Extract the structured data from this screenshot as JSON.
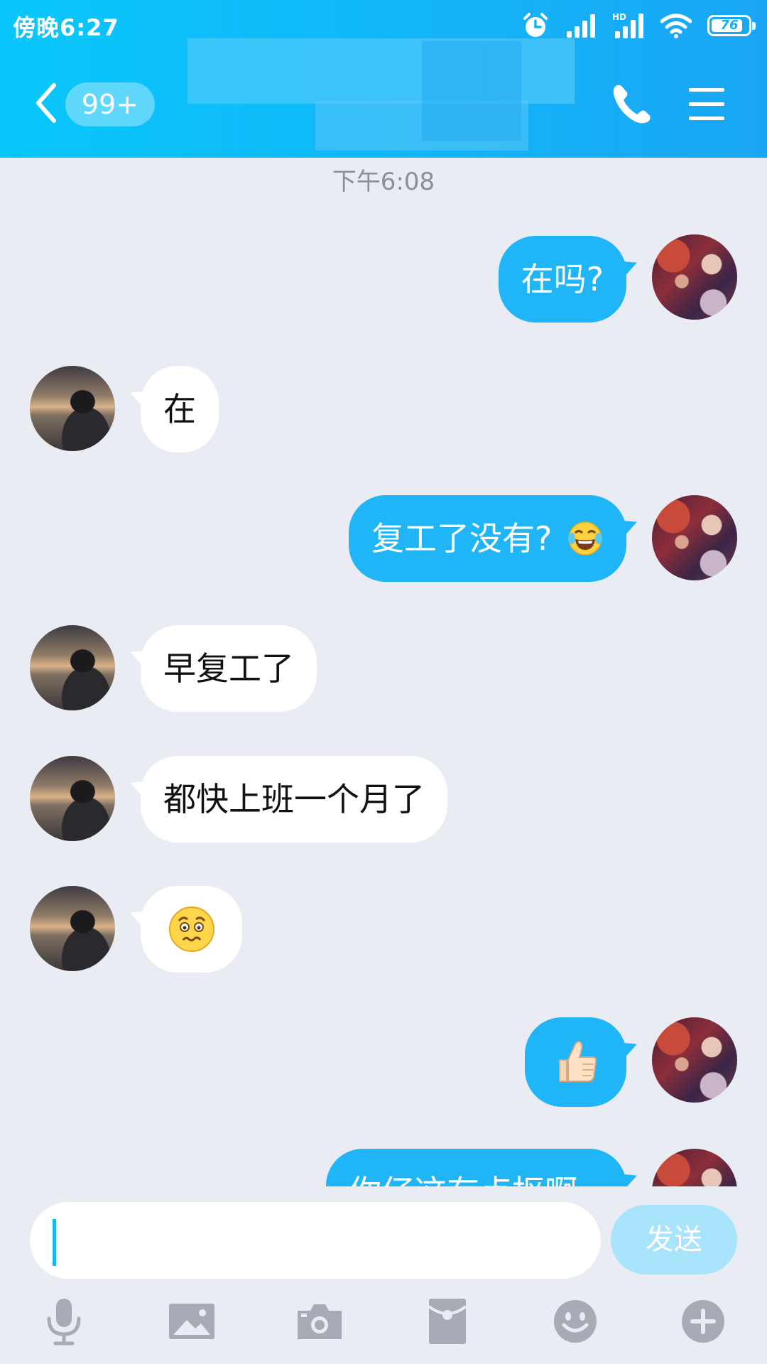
{
  "status_bar": {
    "time": "傍晚6:27",
    "battery": "76",
    "network_label": "HD"
  },
  "header": {
    "unread_badge": "99+",
    "title_hidden": ""
  },
  "chat": {
    "timestamp": "下午6:08",
    "messages": [
      {
        "side": "out",
        "text": "在吗?"
      },
      {
        "side": "in",
        "text": "在"
      },
      {
        "side": "out",
        "text": "复工了没有?",
        "emoji": "laugh-cry-emoji"
      },
      {
        "side": "in",
        "text": "早复工了"
      },
      {
        "side": "in",
        "text": "都快上班一个月了"
      },
      {
        "side": "in",
        "emoji": "worried-face-emoji"
      },
      {
        "side": "out",
        "emoji": "thumbs-up-emoji"
      },
      {
        "side": "out",
        "text": "你仔这有点抠啊"
      }
    ]
  },
  "input": {
    "value": "",
    "send_label": "发送"
  },
  "toolbar": {
    "items": [
      "microphone-icon",
      "image-icon",
      "camera-icon",
      "red-packet-icon",
      "emoji-icon",
      "plus-icon"
    ]
  },
  "colors": {
    "header": "#12b5f7",
    "bubble_out": "#20b5f6",
    "bubble_in": "#ffffff",
    "background": "#e9ecf3",
    "send_disabled": "#a8e4fb"
  }
}
